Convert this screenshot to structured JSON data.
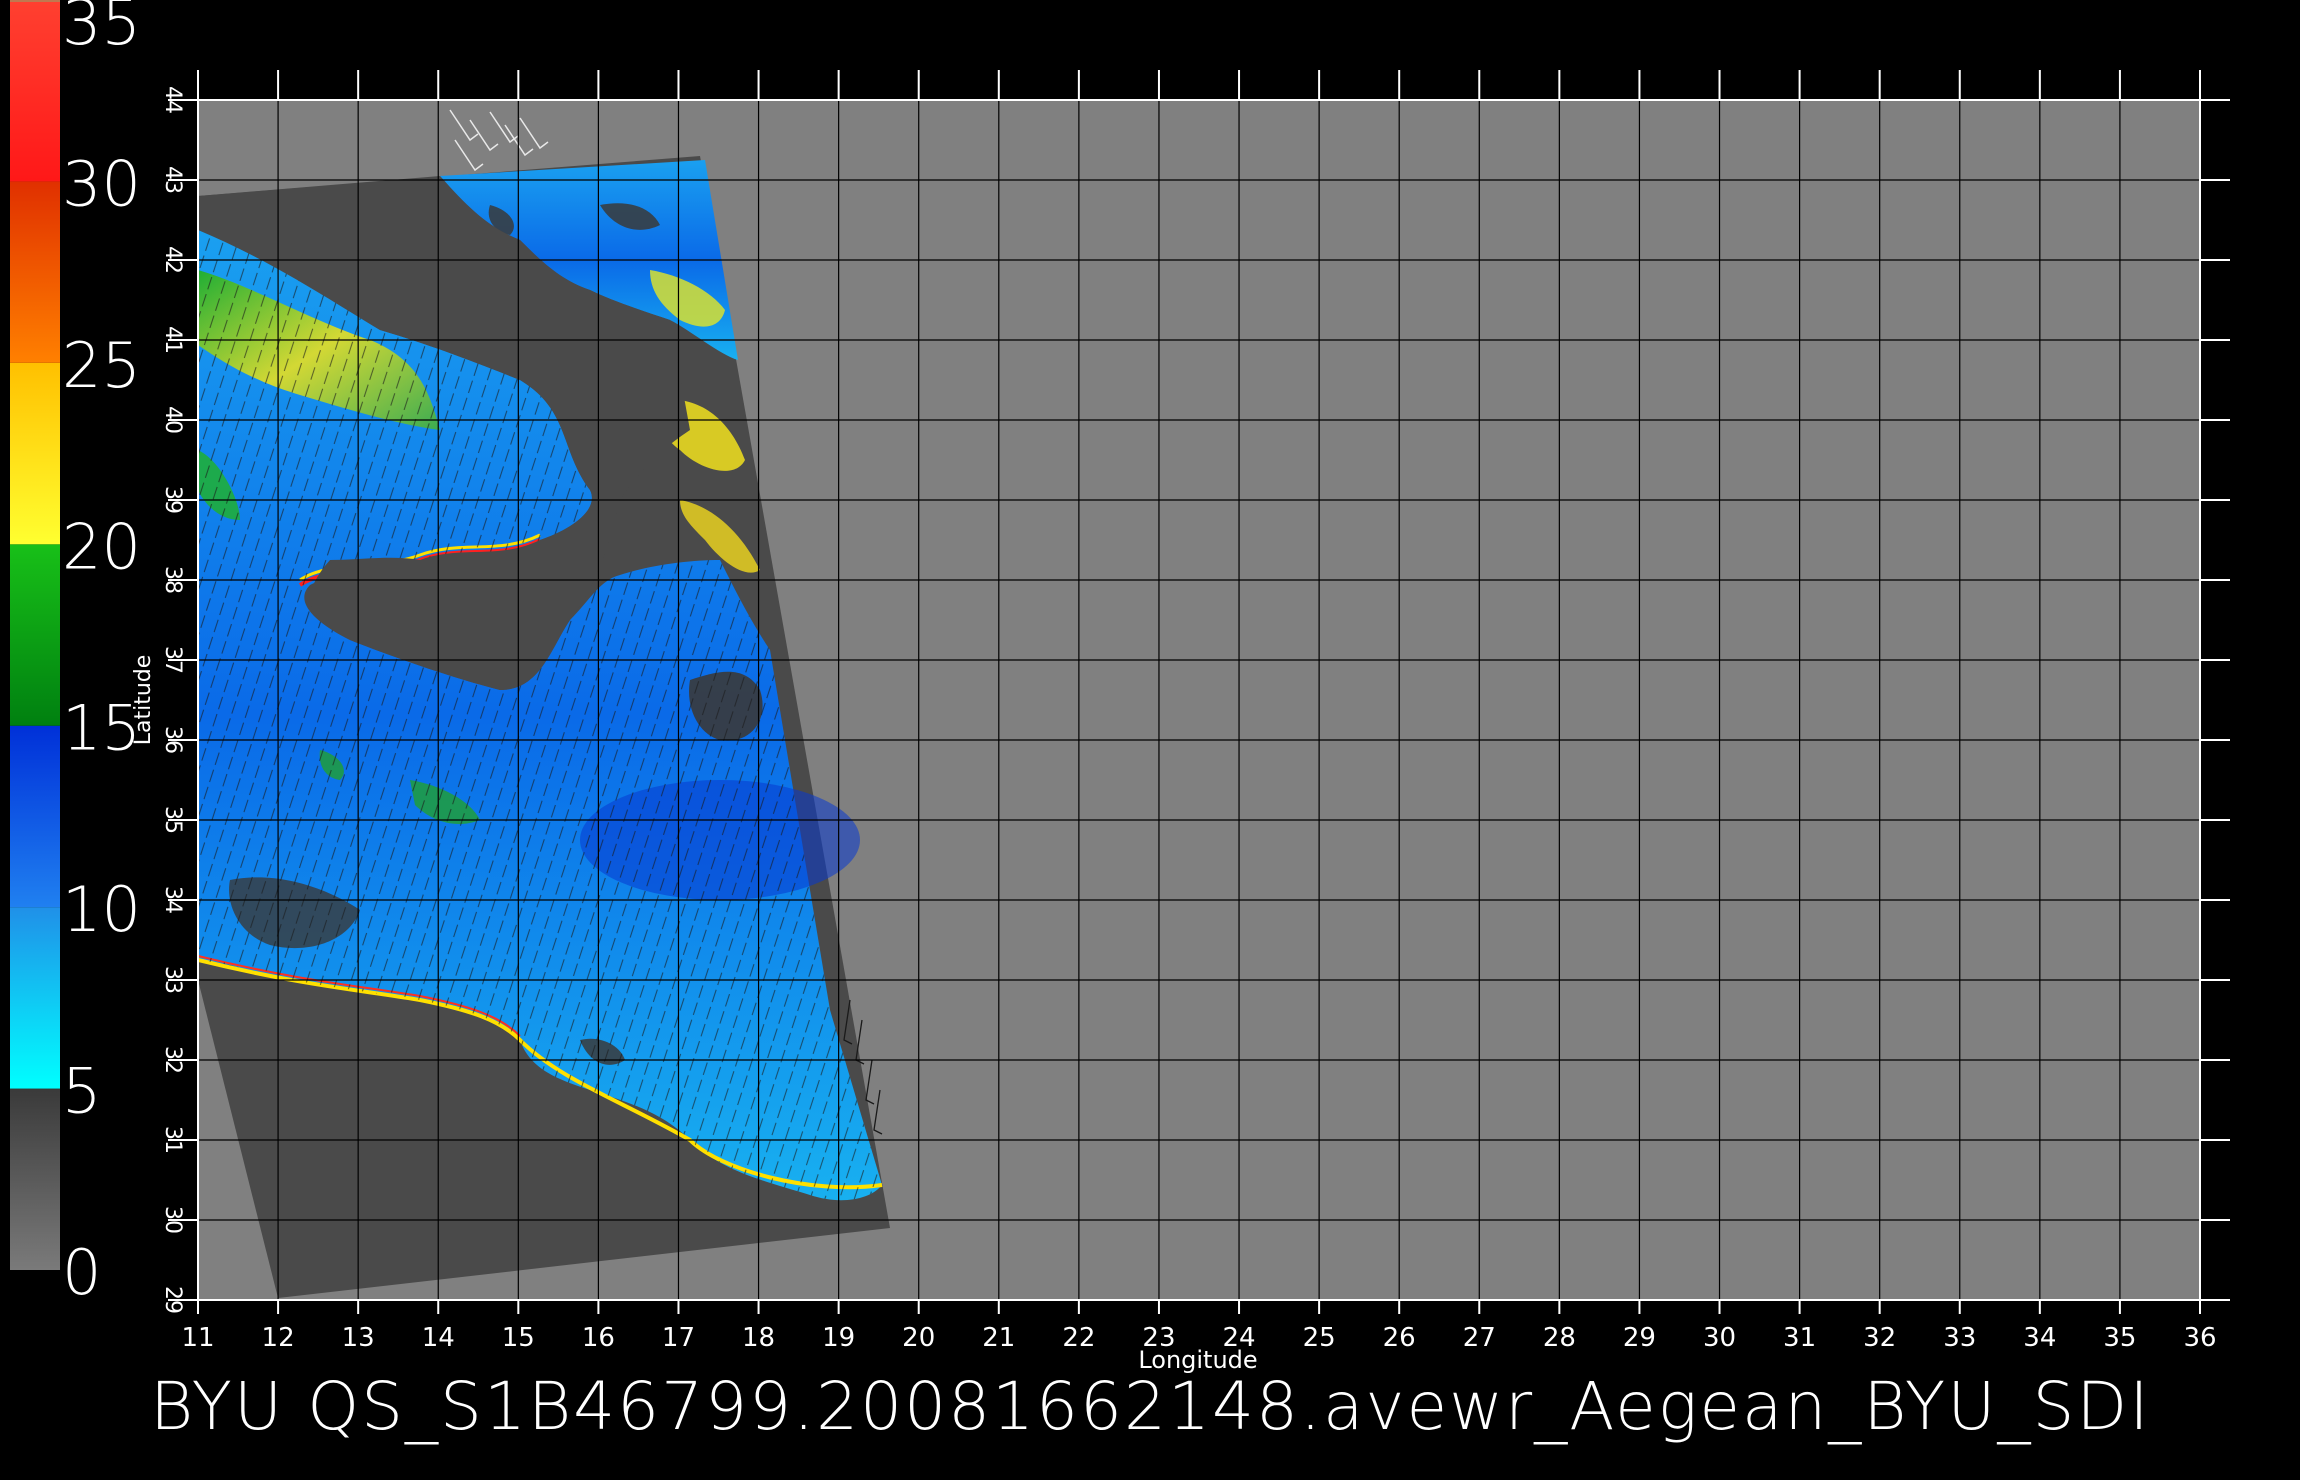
{
  "caption": "BYU  QS_S1B46799.20081662148.avewr_Aegean_BYU_SDI",
  "axes": {
    "xlabel": "Longitude",
    "ylabel": "Latitude",
    "xlim": [
      11,
      36
    ],
    "ylim": [
      29,
      44
    ],
    "xticks": [
      "11",
      "12",
      "13",
      "14",
      "15",
      "16",
      "17",
      "18",
      "19",
      "20",
      "21",
      "22",
      "23",
      "24",
      "25",
      "26",
      "27",
      "28",
      "29",
      "30",
      "31",
      "32",
      "33",
      "34",
      "35",
      "36"
    ],
    "yticks": [
      "29",
      "30",
      "31",
      "32",
      "33",
      "34",
      "35",
      "36",
      "37",
      "38",
      "39",
      "40",
      "41",
      "42",
      "43",
      "44"
    ]
  },
  "colorbar": {
    "labels": [
      "0",
      "5",
      "10",
      "15",
      "20",
      "25",
      "30",
      "35"
    ],
    "range": [
      0,
      35
    ],
    "bands": [
      {
        "from": 0,
        "to": 5,
        "color": "#555555"
      },
      {
        "from": 5,
        "to": 10,
        "color": "#00c8f0"
      },
      {
        "from": 10,
        "to": 15,
        "color": "#0040e8"
      },
      {
        "from": 15,
        "to": 20,
        "color": "#10a020"
      },
      {
        "from": 20,
        "to": 25,
        "color": "#ffe000"
      },
      {
        "from": 25,
        "to": 30,
        "color": "#ff6010"
      },
      {
        "from": 30,
        "to": 35,
        "color": "#ff2020"
      }
    ]
  },
  "colors": {
    "background": "#000000",
    "plot_area": "#808080",
    "swath": "#4a4a4a",
    "land": "#4a4a4a",
    "grid": "#000000"
  }
}
